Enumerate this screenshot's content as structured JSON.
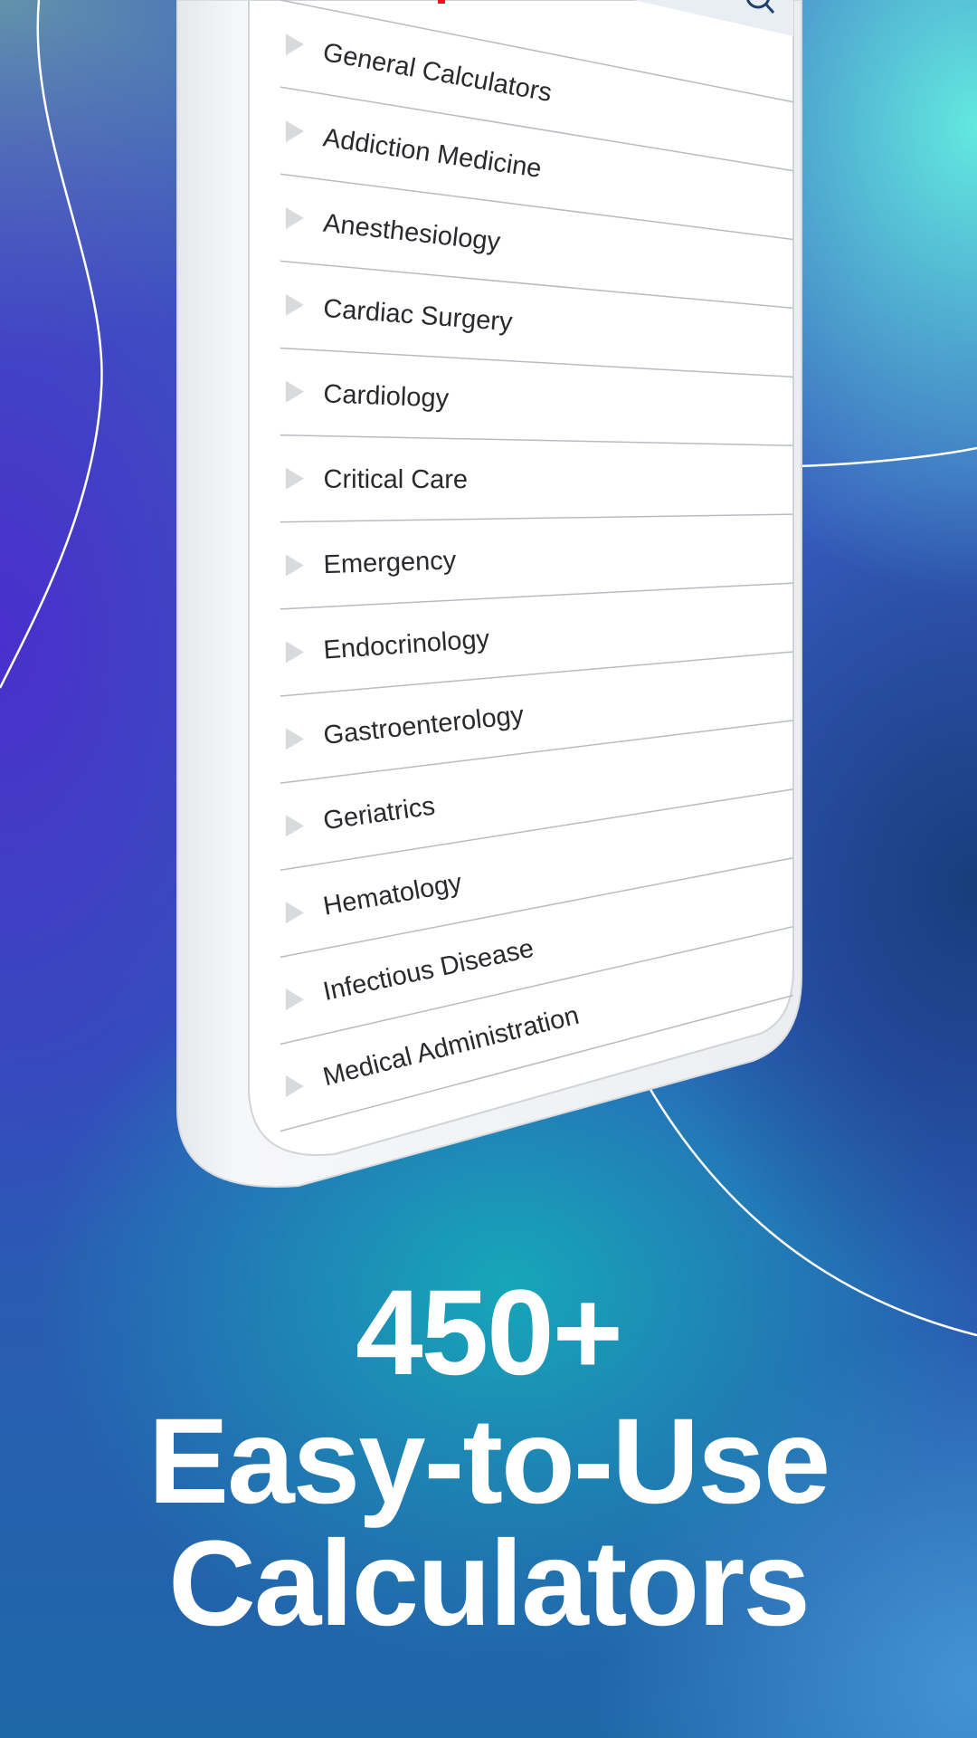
{
  "categories": {
    "items": [
      {
        "label": "General Calculators",
        "icon": "triangle-right-icon"
      },
      {
        "label": "Addiction Medicine",
        "icon": "triangle-right-icon"
      },
      {
        "label": "Anesthesiology",
        "icon": "triangle-right-icon"
      },
      {
        "label": "Cardiac Surgery",
        "icon": "triangle-right-icon"
      },
      {
        "label": "Cardiology",
        "icon": "triangle-right-icon"
      },
      {
        "label": "Critical Care",
        "icon": "triangle-right-icon"
      },
      {
        "label": "Emergency",
        "icon": "triangle-right-icon"
      },
      {
        "label": "Endocrinology",
        "icon": "triangle-right-icon"
      },
      {
        "label": "Gastroenterology",
        "icon": "triangle-right-icon"
      },
      {
        "label": "Geriatrics",
        "icon": "triangle-right-icon"
      },
      {
        "label": "Hematology",
        "icon": "triangle-right-icon"
      },
      {
        "label": "Infectious Disease",
        "icon": "triangle-right-icon"
      },
      {
        "label": "Medical Administration",
        "icon": "triangle-right-icon"
      }
    ]
  },
  "search": {
    "icon": "search-icon"
  },
  "headline": {
    "line1": "450+",
    "line2": "Easy-to-Use",
    "line3": "Calculators"
  },
  "colors": {
    "accent_red": "#e8141c",
    "search_icon": "#1f3f6e",
    "text": "#2a2a2e",
    "headline": "#ffffff"
  }
}
